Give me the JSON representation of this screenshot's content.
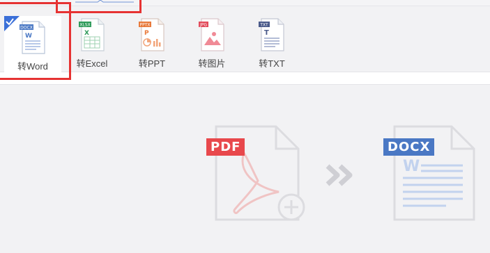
{
  "toolbar": {
    "items": [
      {
        "label": "转Word",
        "badge": "DOCX",
        "color": "#4a78c4",
        "selected": true
      },
      {
        "label": "转Excel",
        "badge": "XLSX",
        "color": "#2e9a5a",
        "selected": false
      },
      {
        "label": "转PPT",
        "badge": "PPTX",
        "color": "#e8793a",
        "selected": false
      },
      {
        "label": "转图片",
        "badge": "JPG",
        "color": "#e24a5a",
        "selected": false
      },
      {
        "label": "转TXT",
        "badge": "TXT",
        "color": "#4a5a8a",
        "selected": false
      }
    ]
  },
  "conversion": {
    "source_badge": "PDF",
    "target_badge": "DOCX",
    "source_color": "#e8484c",
    "target_color": "#4a78c4"
  },
  "icons": [
    "check-icon",
    "docx-file-icon",
    "xlsx-file-icon",
    "pptx-file-icon",
    "jpg-file-icon",
    "txt-file-icon",
    "pdf-file-icon",
    "docx-large-file-icon",
    "double-chevron-right-icon",
    "plus-circle-icon"
  ]
}
